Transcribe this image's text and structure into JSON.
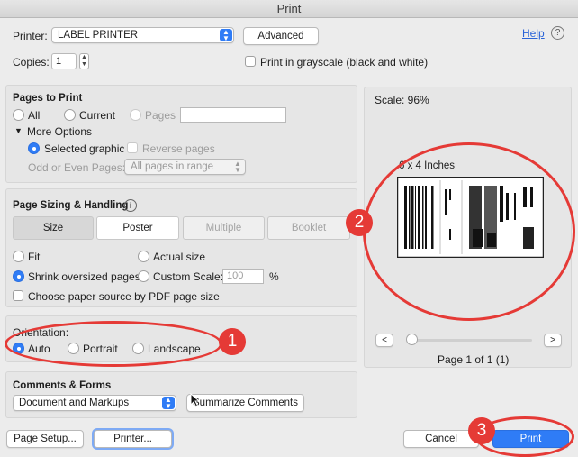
{
  "window": {
    "title": "Print"
  },
  "printer": {
    "label": "Printer:",
    "value": "LABEL PRINTER",
    "advanced": "Advanced",
    "help": "Help",
    "help_glyph": "?"
  },
  "copies": {
    "label": "Copies:",
    "value": "1"
  },
  "grayscale": {
    "label": "Print in grayscale (black and white)"
  },
  "pages_to_print": {
    "title": "Pages to Print",
    "all": "All",
    "current": "Current",
    "pages": "Pages",
    "pages_value": "",
    "more_options": "More Options",
    "selected_graphic": "Selected graphic",
    "reverse_pages": "Reverse pages",
    "odd_even_label": "Odd or Even Pages:",
    "odd_even_value": "All pages in range"
  },
  "sizing": {
    "title": "Page Sizing & Handling",
    "info_glyph": "i",
    "tabs": [
      "Size",
      "Poster",
      "Multiple",
      "Booklet"
    ],
    "fit": "Fit",
    "actual_size": "Actual size",
    "shrink": "Shrink oversized pages",
    "custom_scale": "Custom Scale:",
    "scale_value": "100",
    "percent": "%",
    "paper_source": "Choose paper source by PDF page size"
  },
  "orientation": {
    "title": "Orientation:",
    "auto": "Auto",
    "portrait": "Portrait",
    "landscape": "Landscape"
  },
  "comments": {
    "title": "Comments & Forms",
    "value": "Document and Markups",
    "summarize": "Summarize Comments"
  },
  "preview": {
    "scale": "Scale:  96%",
    "size": "6 x 4 Inches",
    "prev": "<",
    "next": ">",
    "page_info": "Page 1 of 1 (1)"
  },
  "footer": {
    "page_setup": "Page Setup...",
    "printer": "Printer...",
    "cancel": "Cancel",
    "print": "Print"
  },
  "markers": [
    "1",
    "2",
    "3"
  ],
  "colors": {
    "accent": "#2f7cf6",
    "annotation": "#e53a36"
  }
}
